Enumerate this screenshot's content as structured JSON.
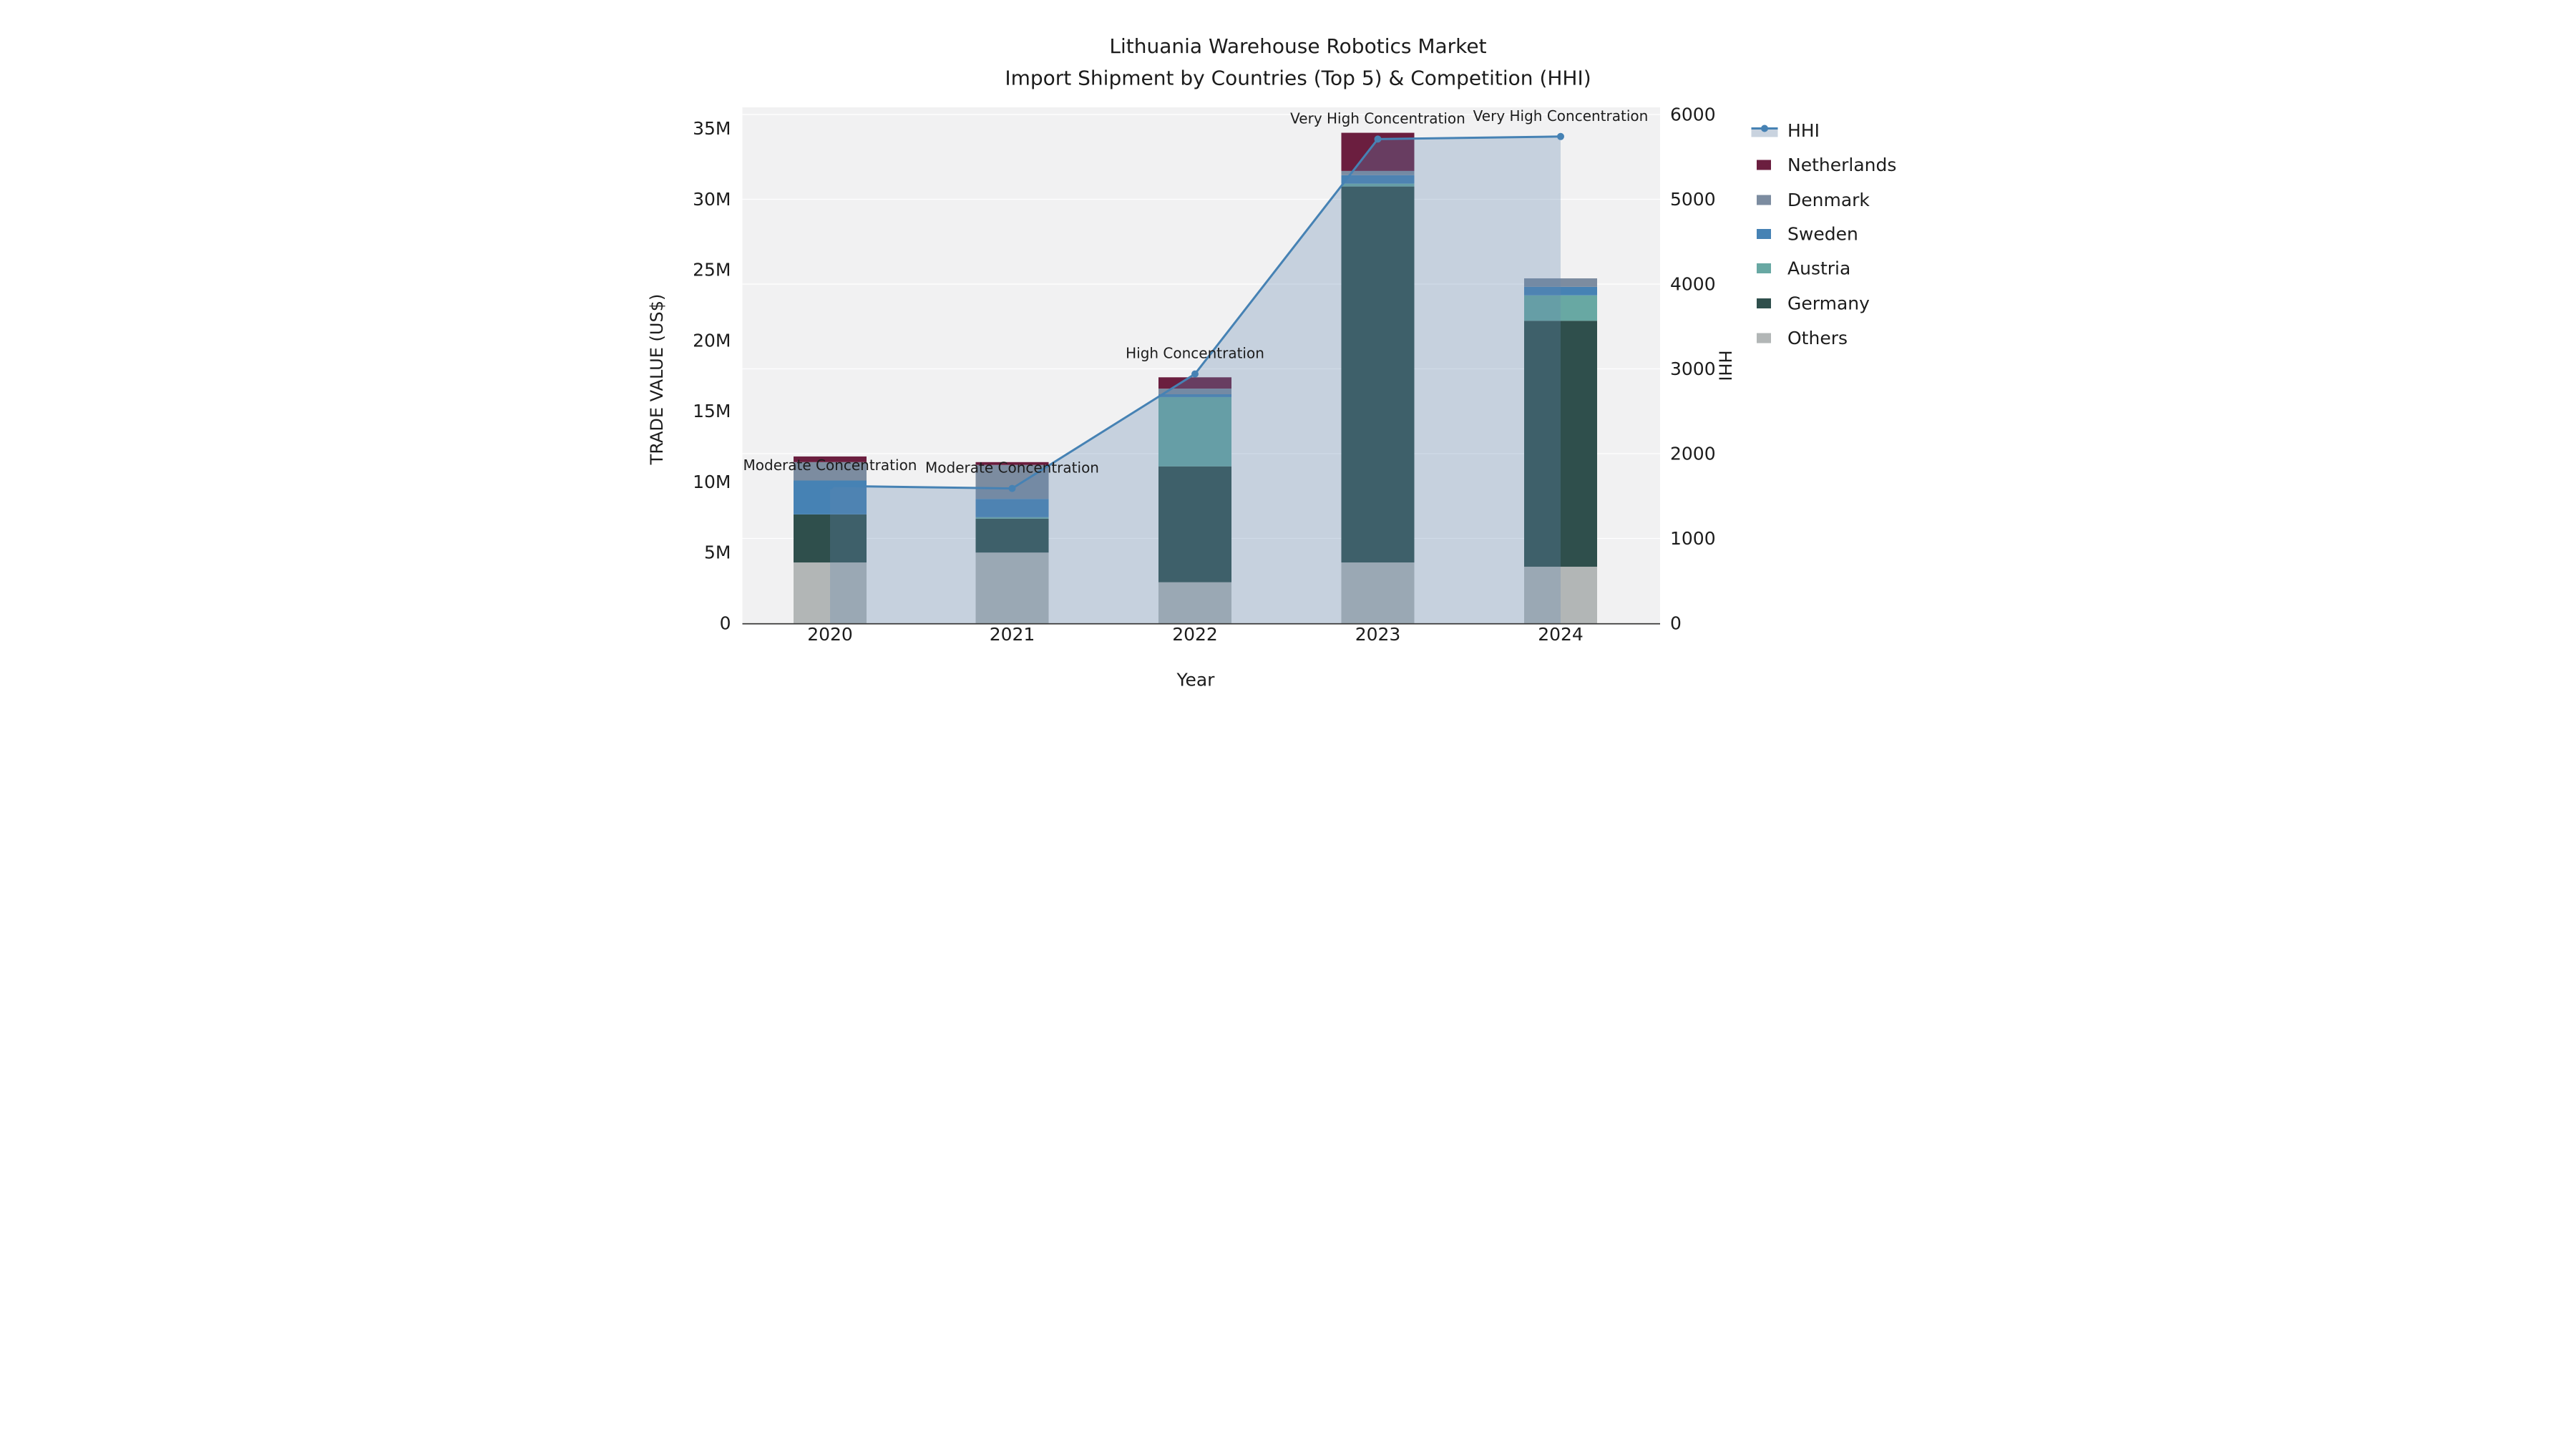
{
  "title": {
    "line1": "Lithuania Warehouse Robotics Market",
    "line2": "Import Shipment by Countries (Top 5) & Competition (HHI)"
  },
  "axes": {
    "x": {
      "title": "Year",
      "ticks": [
        "2020",
        "2021",
        "2022",
        "2023",
        "2024"
      ]
    },
    "y_left": {
      "title": "TRADE VALUE (US$)",
      "ticks": [
        "0",
        "5M",
        "10M",
        "15M",
        "20M",
        "25M",
        "30M",
        "35M"
      ],
      "tick_values_millions": [
        0,
        5,
        10,
        15,
        20,
        25,
        30,
        35
      ],
      "range_millions": [
        0,
        36.5
      ]
    },
    "y_right": {
      "title": "HHI",
      "ticks": [
        "0",
        "1000",
        "2000",
        "3000",
        "4000",
        "5000",
        "6000"
      ],
      "tick_values": [
        0,
        1000,
        2000,
        3000,
        4000,
        5000,
        6000
      ],
      "range": [
        0,
        6000
      ]
    }
  },
  "legend": {
    "items": [
      {
        "label": "HHI",
        "type": "line",
        "color": "#4682B4",
        "band_color": "#c9d3df"
      },
      {
        "label": "Netherlands",
        "type": "swatch",
        "color": "#6B1E3F"
      },
      {
        "label": "Denmark",
        "type": "swatch",
        "color": "#7C8CA0"
      },
      {
        "label": "Sweden",
        "type": "swatch",
        "color": "#4682B4"
      },
      {
        "label": "Austria",
        "type": "swatch",
        "color": "#68A8A3"
      },
      {
        "label": "Germany",
        "type": "swatch",
        "color": "#2F4F4C"
      },
      {
        "label": "Others",
        "type": "swatch",
        "color": "#B2B6B6"
      }
    ]
  },
  "chart_data": {
    "type": "combo_stacked_bar_line",
    "title": "Lithuania Warehouse Robotics Market — Import Shipment by Countries (Top 5) & Competition (HHI)",
    "xlabel": "Year",
    "ylabel": "TRADE VALUE (US$)",
    "y2label": "HHI",
    "categories": [
      "2020",
      "2021",
      "2022",
      "2023",
      "2024"
    ],
    "unit": "US$ millions",
    "ylim_millions": [
      0,
      36.5
    ],
    "y2lim": [
      0,
      6000
    ],
    "grid": "horizontal",
    "legend_position": "right",
    "series": [
      {
        "name": "Netherlands",
        "color": "#6B1E3F",
        "values": [
          0.4,
          0.2,
          0.8,
          2.7,
          0.0
        ]
      },
      {
        "name": "Denmark",
        "color": "#7C8CA0",
        "values": [
          1.3,
          2.4,
          0.4,
          0.3,
          0.6
        ]
      },
      {
        "name": "Sweden",
        "color": "#4682B4",
        "values": [
          2.4,
          1.3,
          0.2,
          0.6,
          0.6
        ]
      },
      {
        "name": "Austria",
        "color": "#68A8A3",
        "values": [
          0.0,
          0.1,
          4.9,
          0.2,
          1.8
        ]
      },
      {
        "name": "Germany",
        "color": "#2F4F4C",
        "values": [
          3.4,
          2.4,
          8.2,
          26.6,
          17.4
        ]
      },
      {
        "name": "Others",
        "color": "#B2B6B6",
        "values": [
          4.3,
          5.0,
          2.9,
          4.3,
          4.0
        ]
      }
    ],
    "stacked_totals_millions": [
      11.8,
      11.4,
      17.4,
      34.7,
      24.4
    ],
    "hhi_line": {
      "name": "HHI",
      "color": "#4682B4",
      "values": [
        1620,
        1590,
        2940,
        5710,
        5740
      ]
    },
    "annotations": [
      "Moderate Concentration",
      "Moderate Concentration",
      "High Concentration",
      "Very High Concentration",
      "Very High Concentration"
    ]
  },
  "colors": {
    "plot_bg": "#f1f1f2",
    "grid": "#ffffff",
    "axis_line": "#3a3a3a",
    "text": "#1c1c1c",
    "hhi_line": "#4682B4",
    "hhi_area_fill": "rgba(100,135,175,0.30)"
  }
}
